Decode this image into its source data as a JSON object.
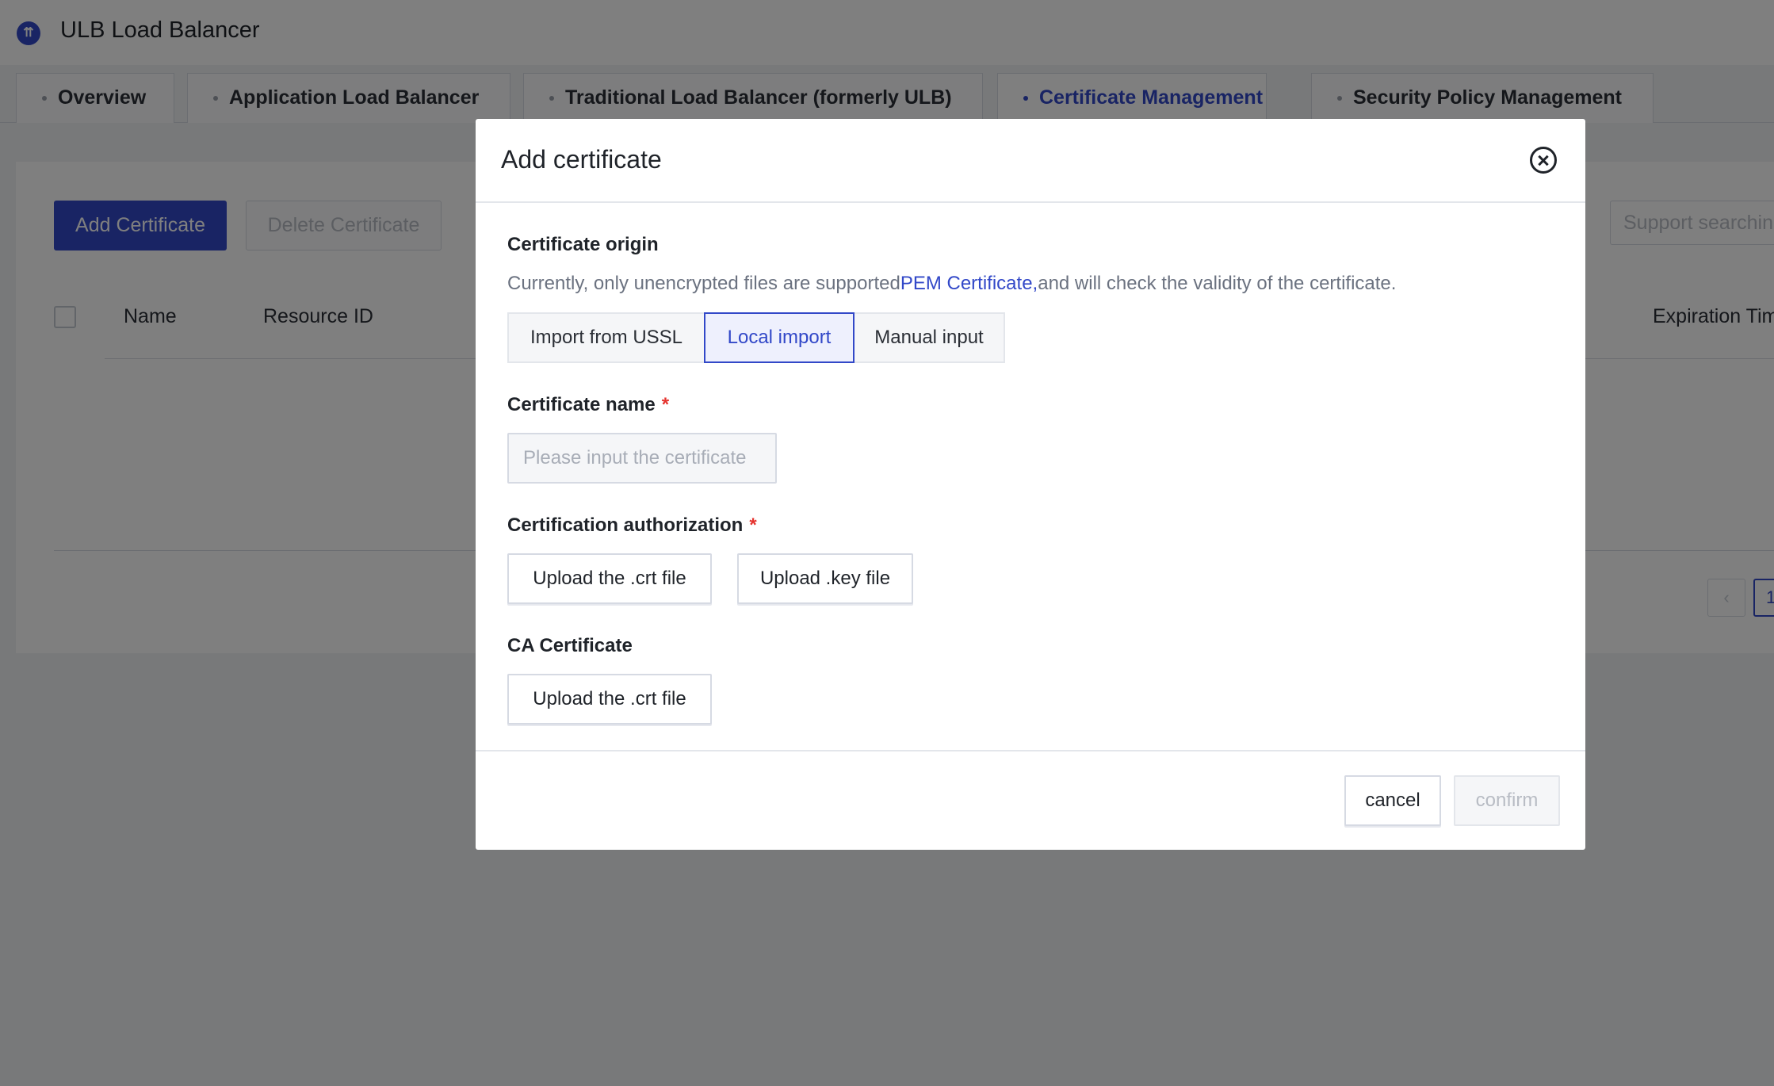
{
  "app": {
    "title": "ULB Load Balancer",
    "logo_icon": "ucloud-logo-icon",
    "accent_color": "#3248c8"
  },
  "tabs": [
    {
      "label": "Overview",
      "active": false
    },
    {
      "label": "Application Load Balancer",
      "active": false
    },
    {
      "label": "Traditional Load Balancer (formerly ULB)",
      "active": false
    },
    {
      "label": "Certificate Management",
      "active": true
    },
    {
      "label": "Security Policy Management",
      "active": false
    }
  ],
  "toolbar": {
    "add_label": "Add Certificate",
    "delete_label": "Delete Certificate",
    "search_placeholder": "Support searchin"
  },
  "table": {
    "columns": [
      "Name",
      "Resource ID",
      "Expiration Tim"
    ]
  },
  "pagination": {
    "prev_icon": "‹",
    "current_page": "1"
  },
  "modal": {
    "title": "Add certificate",
    "close_icon": "close-circle-icon",
    "origin": {
      "label": "Certificate origin",
      "help_prefix": "Currently, only unencrypted files are supported",
      "help_link": "PEM Certificate,",
      "help_suffix": "and will check the validity of the certificate.",
      "options": [
        "Import from USSL",
        "Local import",
        "Manual input"
      ],
      "selected": "Local import"
    },
    "name": {
      "label": "Certificate name",
      "required_mark": "*",
      "placeholder": "Please input the certificate"
    },
    "authorization": {
      "label": "Certification authorization",
      "required_mark": "*",
      "upload_crt": "Upload the .crt file",
      "upload_key": "Upload .key file"
    },
    "ca": {
      "label": "CA Certificate",
      "upload_crt": "Upload the .crt file"
    },
    "footer": {
      "cancel": "cancel",
      "confirm": "confirm"
    }
  }
}
